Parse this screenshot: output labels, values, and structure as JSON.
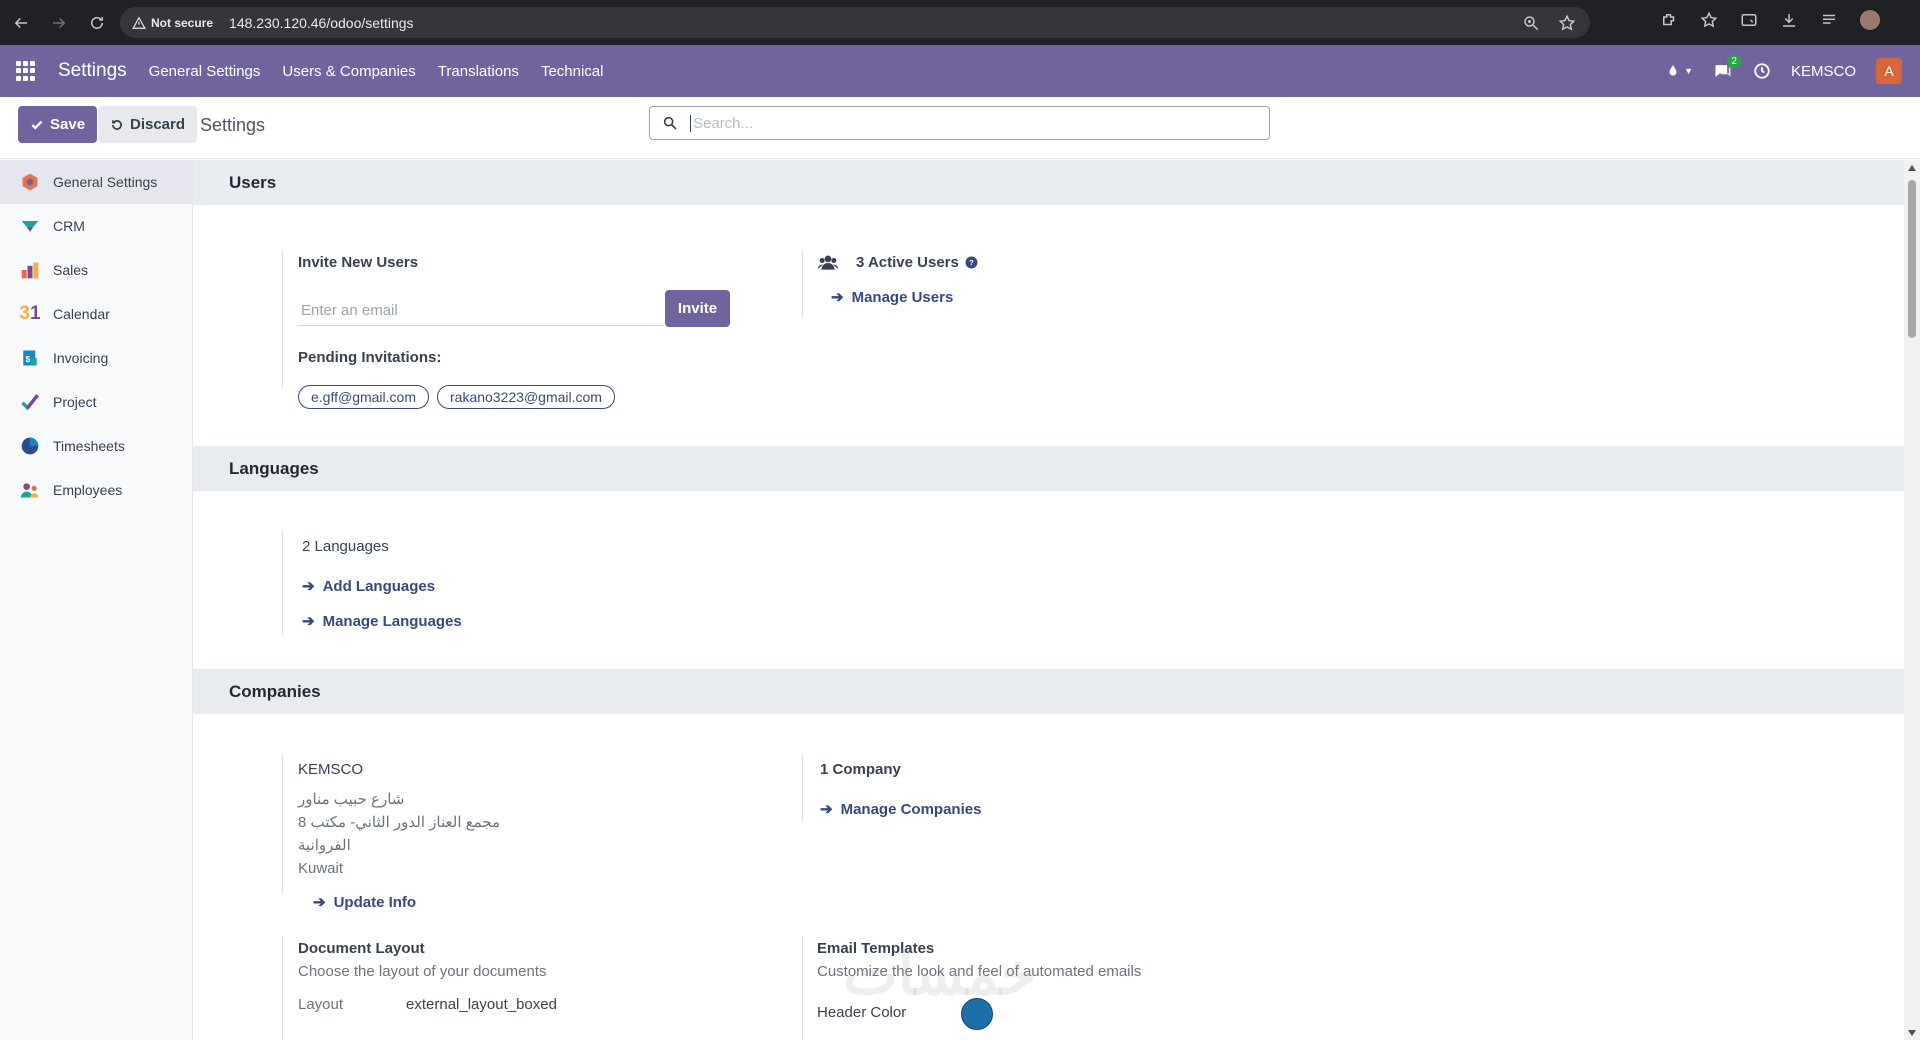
{
  "browser": {
    "security_label": "Not secure",
    "url": "148.230.120.46/odoo/settings"
  },
  "navbar": {
    "brand": "Settings",
    "menu": [
      "General Settings",
      "Users & Companies",
      "Translations",
      "Technical"
    ],
    "messages_count": "2",
    "company": "KEMSCO",
    "user_initial": "A"
  },
  "control": {
    "save_label": "Save",
    "discard_label": "Discard",
    "title": "Settings",
    "search_placeholder": "Search..."
  },
  "sidebar": {
    "items": [
      {
        "label": "General Settings",
        "icon": "general-settings-icon"
      },
      {
        "label": "CRM",
        "icon": "crm-icon"
      },
      {
        "label": "Sales",
        "icon": "sales-icon"
      },
      {
        "label": "Calendar",
        "icon": "calendar-icon"
      },
      {
        "label": "Invoicing",
        "icon": "invoicing-icon"
      },
      {
        "label": "Project",
        "icon": "project-icon"
      },
      {
        "label": "Timesheets",
        "icon": "timesheets-icon"
      },
      {
        "label": "Employees",
        "icon": "employees-icon"
      }
    ]
  },
  "users": {
    "section_title": "Users",
    "invite_title": "Invite New Users",
    "email_placeholder": "Enter an email",
    "invite_label": "Invite",
    "pending_label": "Pending Invitations:",
    "pending": [
      "e.gff@gmail.com",
      "rakano3223@gmail.com"
    ],
    "active_users": "3 Active Users",
    "manage_users": "Manage Users"
  },
  "languages": {
    "section_title": "Languages",
    "count": "2 Languages",
    "add": "Add Languages",
    "manage": "Manage Languages"
  },
  "companies": {
    "section_title": "Companies",
    "company_name": "KEMSCO",
    "address_lines": [
      "شارع حبيب مناور",
      "مجمع العناز الدور الثاني- مكتب 8",
      "الفروانية",
      "Kuwait"
    ],
    "update_info": "Update Info",
    "count": "1 Company",
    "manage": "Manage Companies",
    "doc_layout_title": "Document Layout",
    "doc_layout_desc": "Choose the layout of your documents",
    "layout_label": "Layout",
    "layout_value": "external_layout_boxed",
    "email_templates_title": "Email Templates",
    "email_templates_desc": "Customize the look and feel of automated emails",
    "header_color_label": "Header Color",
    "header_color": "#1e6fa8"
  },
  "colors": {
    "brand": "#71639e",
    "link": "#374a7b"
  }
}
